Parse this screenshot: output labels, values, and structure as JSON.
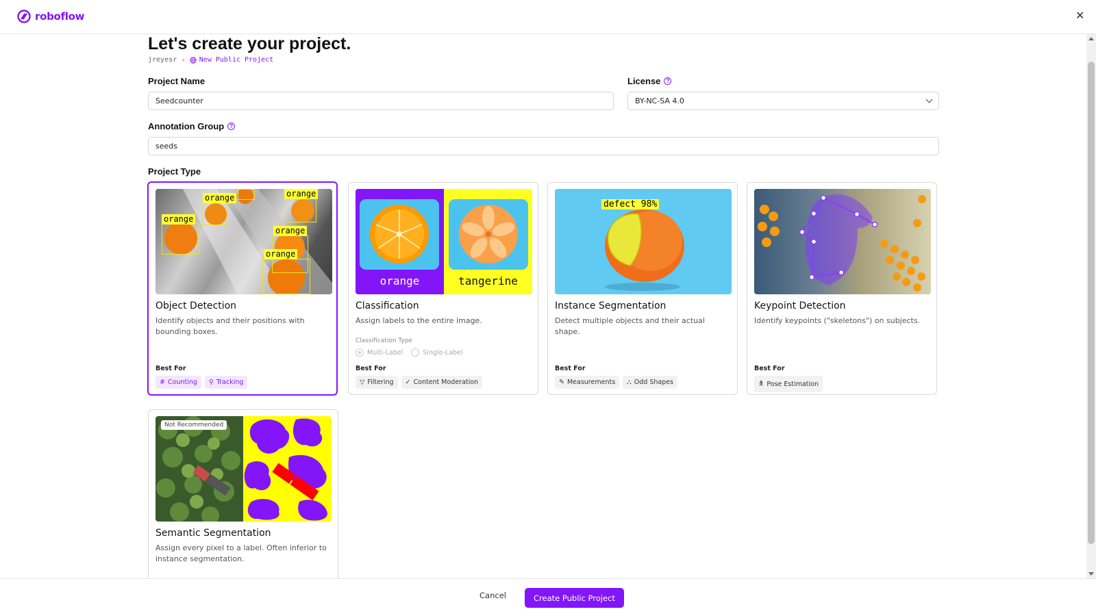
{
  "brand": {
    "name": "roboflow",
    "color": "#8315f9"
  },
  "page": {
    "title": "Let's create your project."
  },
  "breadcrumb": {
    "user": "jreyesr",
    "project": "New Public Project"
  },
  "form": {
    "project_name_label": "Project Name",
    "project_name_value": "Seedcounter",
    "license_label": "License",
    "license_value": "BY-NC-SA 4.0",
    "annotation_group_label": "Annotation Group",
    "annotation_group_value": "seeds",
    "project_type_label": "Project Type"
  },
  "cards": {
    "object_detection": {
      "title": "Object Detection",
      "desc": "Identify objects and their positions with bounding boxes.",
      "best_for": "Best For",
      "tags": [
        "Counting",
        "Tracking"
      ],
      "image_labels": [
        "orange",
        "orange",
        "orange",
        "orange",
        "orange"
      ],
      "selected": true
    },
    "classification": {
      "title": "Classification",
      "desc": "Assign labels to the entire image.",
      "classification_type_label": "Classification Type",
      "options": [
        "Multi-Label",
        "Single-Label"
      ],
      "best_for": "Best For",
      "tags": [
        "Filtering",
        "Content Moderation"
      ],
      "image_labels": [
        "orange",
        "tangerine"
      ]
    },
    "instance_segmentation": {
      "title": "Instance Segmentation",
      "desc": "Detect multiple objects and their actual shape.",
      "best_for": "Best For",
      "tags": [
        "Measurements",
        "Odd Shapes"
      ],
      "image_label": "defect 98%"
    },
    "keypoint_detection": {
      "title": "Keypoint Detection",
      "desc": "Identify keypoints (\"skeletons\") on subjects.",
      "best_for": "Best For",
      "tags": [
        "Pose Estimation"
      ]
    },
    "semantic_segmentation": {
      "title": "Semantic Segmentation",
      "desc": "Assign every pixel to a label. Often inferior to instance segmentation.",
      "badge": "Not Recommended"
    }
  },
  "footer": {
    "cancel": "Cancel",
    "create": "Create Public Project"
  }
}
